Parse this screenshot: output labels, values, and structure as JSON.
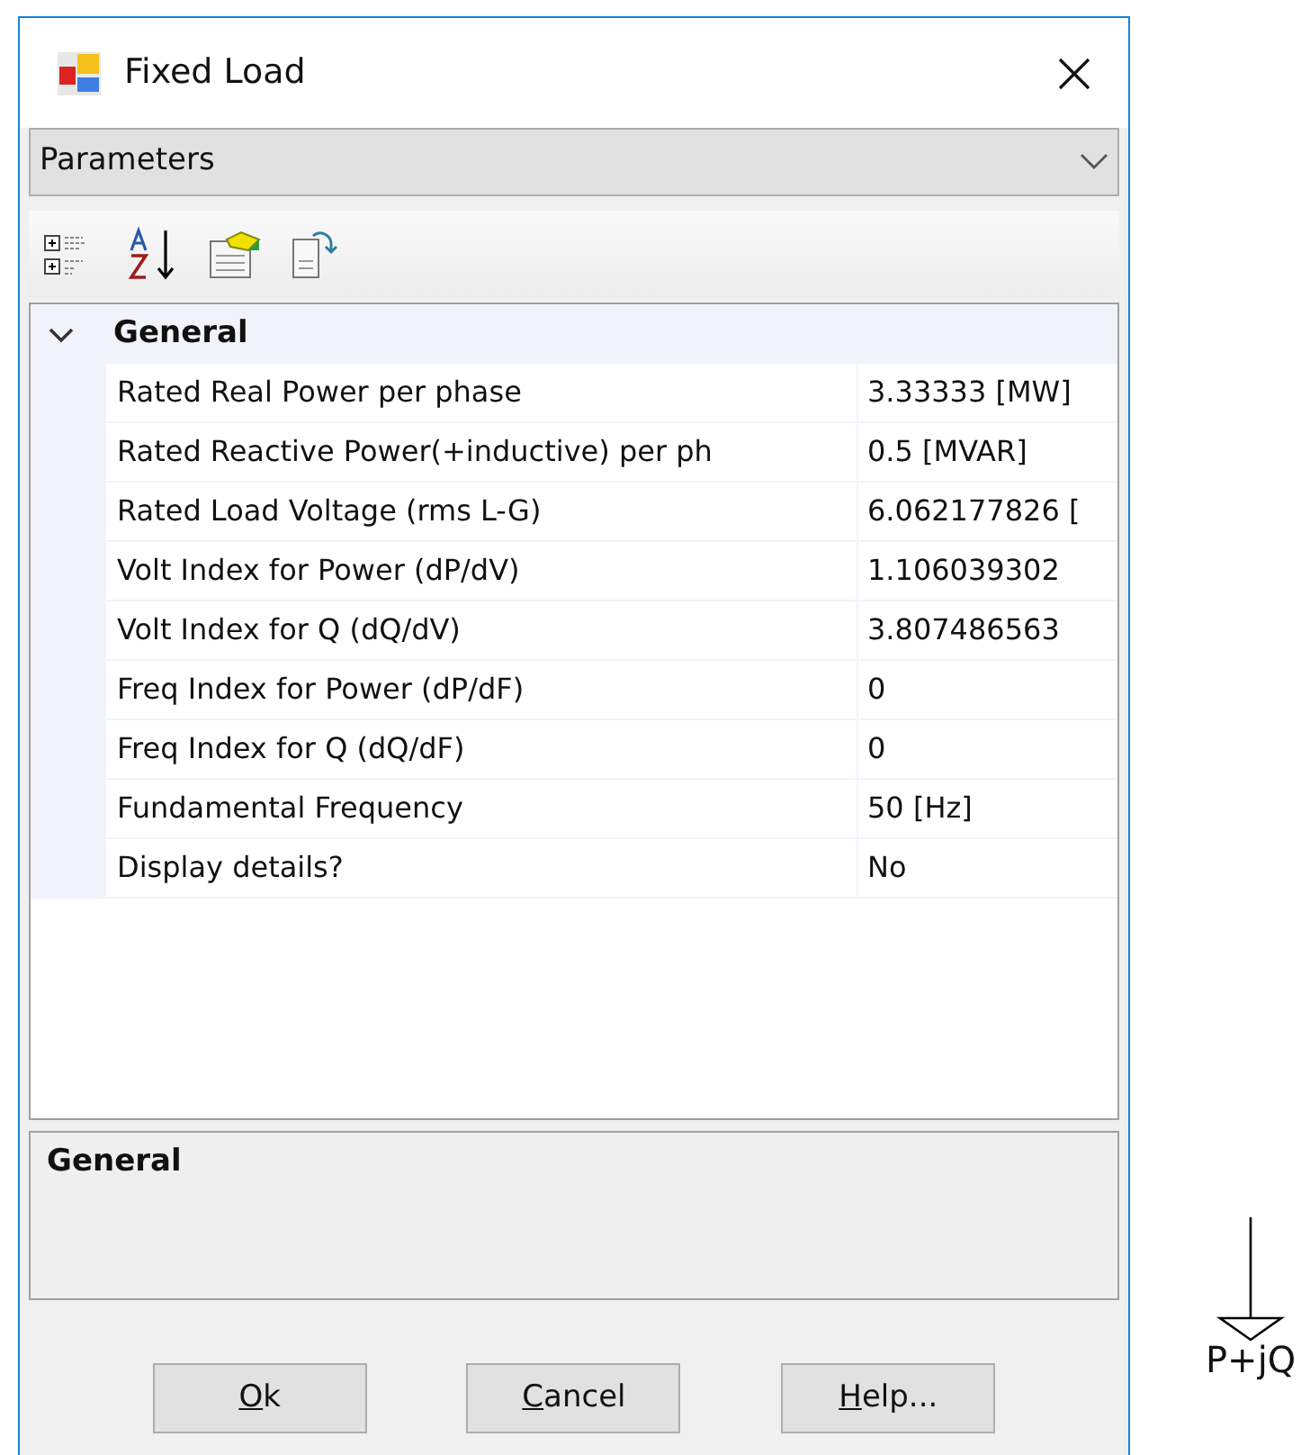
{
  "window": {
    "title": "Fixed Load"
  },
  "section_dropdown": {
    "value": "Parameters"
  },
  "category": {
    "label": "General",
    "expanded": true
  },
  "properties": [
    {
      "name": "Rated Real Power per phase",
      "value": "3.33333 [MW]"
    },
    {
      "name": "Rated Reactive Power(+inductive) per ph",
      "value": "0.5 [MVAR]"
    },
    {
      "name": "Rated Load Voltage (rms L-G)",
      "value": "6.062177826 ["
    },
    {
      "name": "Volt Index for Power (dP/dV)",
      "value": "1.106039302"
    },
    {
      "name": "Volt Index for Q (dQ/dV)",
      "value": "3.807486563"
    },
    {
      "name": "Freq Index for Power (dP/dF)",
      "value": "0"
    },
    {
      "name": "Freq Index for Q (dQ/dF)",
      "value": "0"
    },
    {
      "name": "Fundamental Frequency",
      "value": "50 [Hz]"
    },
    {
      "name": "Display details?",
      "value": "No"
    }
  ],
  "description": {
    "title": "General"
  },
  "buttons": [
    {
      "mnemonic": "O",
      "rest": "k"
    },
    {
      "mnemonic": "C",
      "rest": "ancel"
    },
    {
      "mnemonic": "H",
      "rest": "elp..."
    }
  ],
  "symbol": {
    "label": "P+jQ"
  }
}
